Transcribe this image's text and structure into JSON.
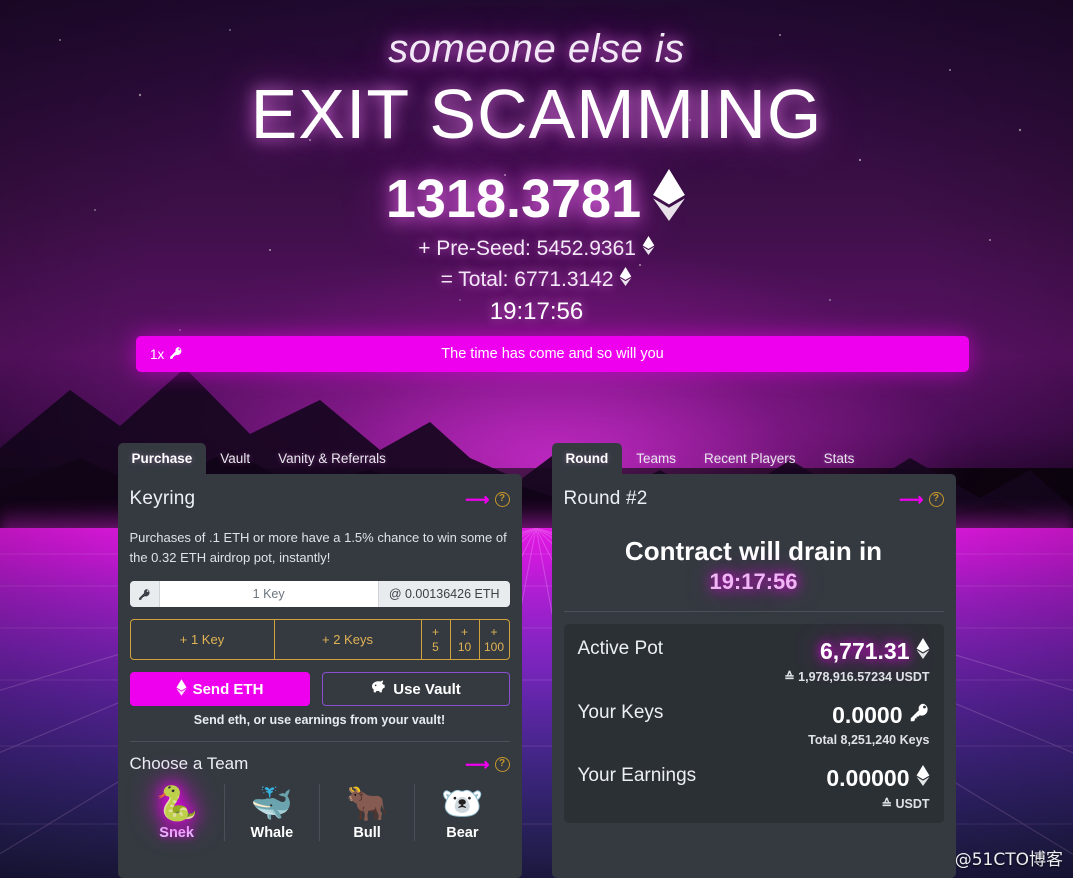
{
  "hero": {
    "subtitle": "someone else is",
    "title": "EXIT SCAMMING",
    "amount": "1318.3781",
    "preseed_line": "+ Pre-Seed: 5452.9361",
    "total_line": "= Total: 6771.3142",
    "clock": "19:17:56"
  },
  "banner": {
    "multiplier": "1x",
    "key_icon": "key-icon",
    "message": "The time has come and so will you",
    "color": "#ee00ee"
  },
  "left_panel": {
    "tabs": [
      {
        "label": "Purchase",
        "active": true
      },
      {
        "label": "Vault",
        "active": false
      },
      {
        "label": "Vanity & Referrals",
        "active": false
      }
    ],
    "title": "Keyring",
    "arrow_icon": "arrow-right-icon",
    "help_icon": "question-circle-icon",
    "note": "Purchases of .1 ETH or more have a 1.5% chance to win some of the 0.32 ETH airdrop pot, instantly!",
    "input": {
      "addon_icon": "key-icon",
      "placeholder": "1 Key",
      "value": "",
      "rate": "@ 0.00136426 ETH"
    },
    "key_buttons": [
      {
        "label": "+ 1 Key"
      },
      {
        "label": "+ 2 Keys"
      },
      {
        "sign": "+",
        "num": "5"
      },
      {
        "sign": "+",
        "num": "10"
      },
      {
        "sign": "+",
        "num": "100"
      }
    ],
    "send_button": "Send ETH",
    "send_icon": "ethereum-icon",
    "vault_button": "Use Vault",
    "vault_icon": "piggy-bank-icon",
    "action_hint": "Send eth, or use earnings from your vault!",
    "team_title": "Choose a Team",
    "teams": [
      {
        "label": "Snek",
        "emoji": "🐍",
        "selected": true
      },
      {
        "label": "Whale",
        "emoji": "🐳",
        "selected": false
      },
      {
        "label": "Bull",
        "emoji": "🐂",
        "selected": false
      },
      {
        "label": "Bear",
        "emoji": "🐻‍❄️",
        "selected": false
      }
    ]
  },
  "right_panel": {
    "tabs": [
      {
        "label": "Round",
        "active": true
      },
      {
        "label": "Teams",
        "active": false
      },
      {
        "label": "Recent Players",
        "active": false
      },
      {
        "label": "Stats",
        "active": false
      }
    ],
    "title": "Round #2",
    "arrow_icon": "arrow-right-icon",
    "help_icon": "question-circle-icon",
    "drain_heading": "Contract will drain in",
    "drain_clock": "19:17:56",
    "stats": [
      {
        "label": "Active Pot",
        "value": "6,771.31",
        "unit_icon": "ethereum-icon",
        "sub": "≙ 1,978,916.57234 USDT",
        "glow": true
      },
      {
        "label": "Your Keys",
        "value": "0.0000",
        "unit_icon": "key-icon",
        "sub": "Total 8,251,240 Keys",
        "glow": false
      },
      {
        "label": "Your Earnings",
        "value": "0.00000",
        "unit_icon": "ethereum-icon",
        "sub": "≙ USDT",
        "glow": false
      }
    ]
  },
  "watermark": "@51CTO博客"
}
